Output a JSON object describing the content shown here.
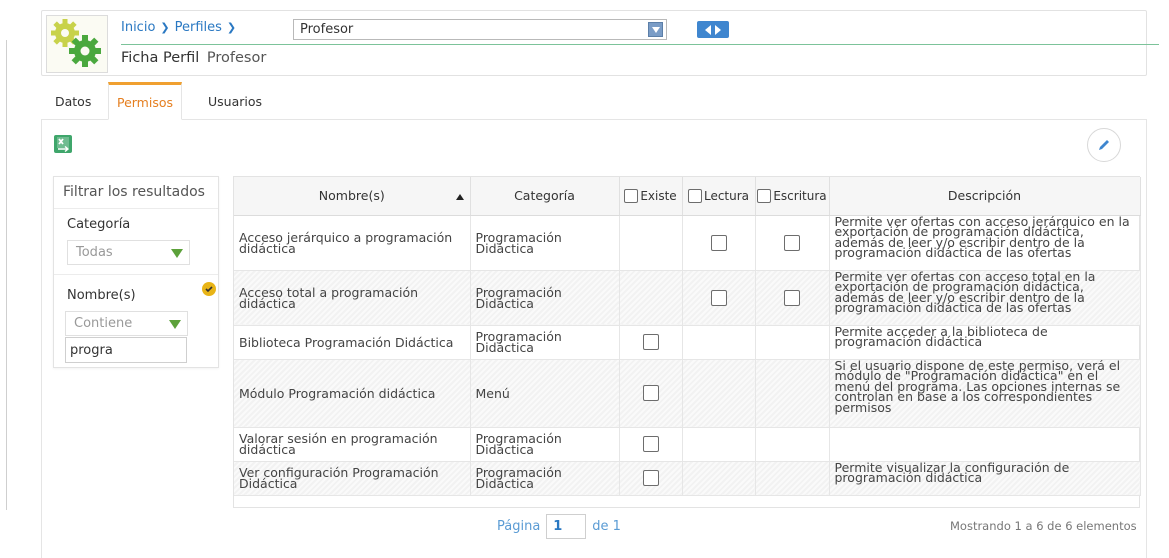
{
  "breadcrumb": {
    "home": "Inicio",
    "profiles": "Perfiles"
  },
  "profile_selector": {
    "value": "Profesor"
  },
  "page_title": {
    "label": "Ficha Perfil",
    "value": "Profesor"
  },
  "tabs": [
    {
      "label": "Datos",
      "active": false
    },
    {
      "label": "Permisos",
      "active": true
    },
    {
      "label": "Usuarios",
      "active": false
    }
  ],
  "filter": {
    "title": "Filtrar los resultados",
    "category_label": "Categoría",
    "category_value": "Todas",
    "name_label": "Nombre(s)",
    "name_operator": "Contiene",
    "name_value": "progra"
  },
  "table": {
    "headers": {
      "name": "Nombre(s)",
      "category": "Categoría",
      "exists": "Existe",
      "read": "Lectura",
      "write": "Escritura",
      "description": "Descripción"
    },
    "rows": [
      {
        "name": "Acceso jerárquico a programación didáctica",
        "category": "Programación Didáctica",
        "existe": null,
        "lectura": false,
        "escritura": false,
        "description": "Permite ver ofertas con acceso jerárquico en la exportación de programación didáctica, además de leer y/o escribir dentro de la programación didáctica de las ofertas"
      },
      {
        "name": "Acceso total a programación didáctica",
        "category": "Programación Didáctica",
        "existe": null,
        "lectura": false,
        "escritura": false,
        "description": "Permite ver ofertas con acceso total en la exportación de programación didáctica, además de leer y/o escribir dentro de la programación didáctica de las ofertas"
      },
      {
        "name": "Biblioteca Programación Didáctica",
        "category": "Programación Didáctica",
        "existe": false,
        "lectura": null,
        "escritura": null,
        "description": "Permite acceder a la biblioteca de programación didáctica"
      },
      {
        "name": "Módulo Programación didáctica",
        "category": "Menú",
        "existe": false,
        "lectura": null,
        "escritura": null,
        "description": "Si el usuario dispone de este permiso, verá el módulo de \"Programación didáctica\" en el menú del programa. Las opciones internas se controlan en base a los correspondientes permisos"
      },
      {
        "name": "Valorar sesión en programación didáctica",
        "category": "Programación Didáctica",
        "existe": false,
        "lectura": null,
        "escritura": null,
        "description": ""
      },
      {
        "name": "Ver configuración Programación Didáctica",
        "category": "Programación Didáctica",
        "existe": false,
        "lectura": null,
        "escritura": null,
        "description": "Permite visualizar la configuración de programación didáctica"
      }
    ]
  },
  "pager": {
    "page_label": "Página",
    "page_value": "1",
    "of_label": "de 1",
    "info": "Mostrando 1 a 6 de 6 elementos"
  },
  "colors": {
    "link": "#2a78c2",
    "active_tab": "#e57f20",
    "accent_green": "#5ca13a",
    "badge": "#e8b417"
  },
  "icons": [
    "gears-logo-icon",
    "dropdown-arrow-icon",
    "prev-next-icon",
    "excel-export-icon",
    "edit-pencil-icon",
    "check-circle-icon",
    "sort-asc-icon"
  ]
}
